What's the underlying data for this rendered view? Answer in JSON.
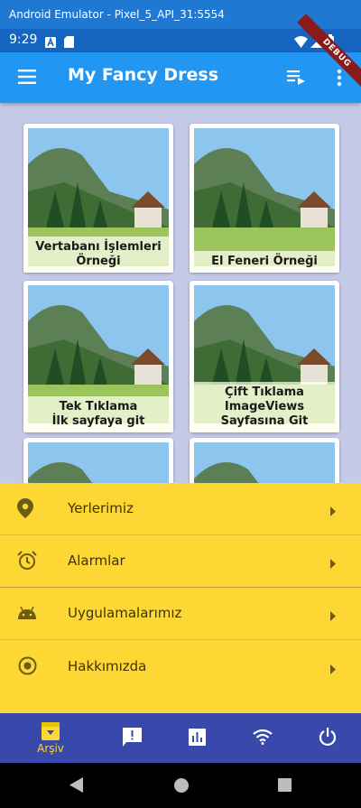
{
  "emulator": {
    "title": "Android Emulator - Pixel_5_API_31:5554"
  },
  "status_bar": {
    "time": "9:29"
  },
  "debug_banner": "DEBUG",
  "app_bar": {
    "title": "My Fancy Dress"
  },
  "grid": {
    "cards": [
      {
        "label": "Vertabanı İşlemleri\nÖrneği"
      },
      {
        "label": "El Feneri Örneği"
      },
      {
        "label": "Tek Tıklama\nİlk sayfaya git"
      },
      {
        "label": "Çift Tıklama\nImageViews\nSayfasına Git"
      },
      {
        "label": ""
      },
      {
        "label": ""
      }
    ]
  },
  "menu": {
    "items": [
      {
        "label": "Yerlerimiz",
        "icon": "location-pin-icon"
      },
      {
        "label": "Alarmlar",
        "icon": "alarm-icon"
      },
      {
        "label": "Uygulamalarımız",
        "icon": "android-icon"
      },
      {
        "label": "Hakkımızda",
        "icon": "radio-button-icon"
      }
    ]
  },
  "bottom_nav": {
    "items": [
      {
        "label": "Arşiv",
        "icon": "archive-icon",
        "selected": true
      },
      {
        "label": "",
        "icon": "feedback-icon"
      },
      {
        "label": "",
        "icon": "bar-chart-icon"
      },
      {
        "label": "",
        "icon": "wifi-icon"
      },
      {
        "label": "",
        "icon": "power-icon"
      }
    ]
  },
  "colors": {
    "app_bar": "#2196f3",
    "status_bar": "#1565c0",
    "content_bg": "#c5cae9",
    "menu_bg": "#fdd835",
    "bottom_nav": "#3949ab",
    "accent": "#fdd835"
  }
}
